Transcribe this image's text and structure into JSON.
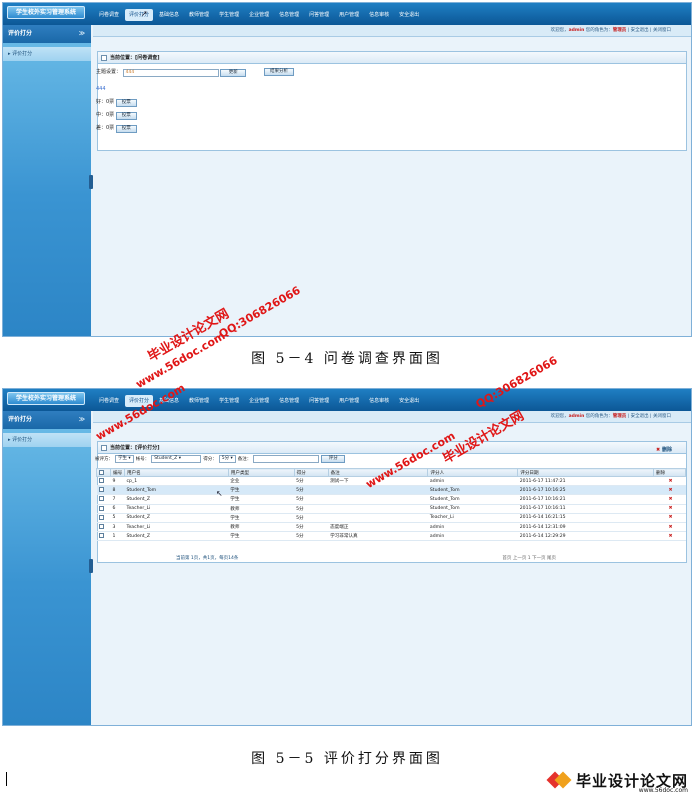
{
  "app_title": "学生校外实习管理系统",
  "nav": [
    "问卷调查",
    "评价打分",
    "基础信息",
    "教师管理",
    "学生管理",
    "企业管理",
    "信息管理",
    "问答管理",
    "用户管理",
    "信息审核",
    "安全退出"
  ],
  "status": {
    "welcome": "欢迎您，",
    "user": "admin",
    "role_prefix": " 您的角色为：",
    "role": "管理员",
    "logout": " | 安全退出",
    "close": " | 关闭窗口"
  },
  "sidebar": {
    "section": "评价打分",
    "item": "评价打分",
    "chevron": "≫"
  },
  "survey": {
    "location": "当前位置：[问卷调查]",
    "topic_label": "主题设置：",
    "topic_value": "444",
    "update_button": "更新",
    "result_button": "结果分析",
    "preview": "444",
    "options": [
      {
        "label": "好：0票",
        "button": "投票"
      },
      {
        "label": "中：0票",
        "button": "投票"
      },
      {
        "label": "差：0票",
        "button": "投票"
      }
    ],
    "caption": "图 5－4 问卷调查界面图"
  },
  "rating": {
    "location": "当前位置：[评价打分]",
    "delete_link": "删除",
    "filter": {
      "target_label": "被评方：",
      "target_value": "学生",
      "account_label": "帐号：",
      "account_value": "Student_Z",
      "score_label": "得分：",
      "score_value": "5分",
      "remark_label": "备注：",
      "submit": "评分"
    },
    "columns": [
      "编号",
      "用户名",
      "用户类型",
      "得分",
      "备注",
      "评分人",
      "评分日期",
      "删除"
    ],
    "rows": [
      {
        "id": "9",
        "user": "cp_1",
        "type": "企业",
        "score": "5分",
        "note": "测试一下",
        "rater": "admin",
        "date": "2011-6-17 11:47:21"
      },
      {
        "id": "8",
        "user": "Student_Tom",
        "type": "学生",
        "score": "5分",
        "note": "",
        "rater": "Student_Tom",
        "date": "2011-6-17 10:16:25"
      },
      {
        "id": "7",
        "user": "Student_Z",
        "type": "学生",
        "score": "5分",
        "note": "",
        "rater": "Student_Tom",
        "date": "2011-6-17 10:16:21"
      },
      {
        "id": "6",
        "user": "Teacher_Li",
        "type": "教师",
        "score": "5分",
        "note": "",
        "rater": "Student_Tom",
        "date": "2011-6-17 10:16:11"
      },
      {
        "id": "5",
        "user": "Student_Z",
        "type": "学生",
        "score": "5分",
        "note": "",
        "rater": "Teacher_Li",
        "date": "2011-6-14 16:21:15"
      },
      {
        "id": "3",
        "user": "Teacher_Li",
        "type": "教师",
        "score": "5分",
        "note": "态度端正",
        "rater": "admin",
        "date": "2011-6-14 12:31:09"
      },
      {
        "id": "1",
        "user": "Student_Z",
        "type": "学生",
        "score": "5分",
        "note": "学习非常认真",
        "rater": "admin",
        "date": "2011-6-14 12:29:29"
      }
    ],
    "delete_mark": "✖",
    "pager_info": "当前第 1页，共1页，每页14条",
    "pager_nav": "首页 上一页 1 下一页 尾页",
    "caption": "图 5－5 评价打分界面图"
  },
  "watermarks": {
    "brand": "毕业设计论文网",
    "url": "www.56doc.com",
    "qq": "QQ:306826066"
  },
  "footer": {
    "brand": "毕业设计论文网",
    "url": "www.56doc.com"
  },
  "colors": {
    "frame_blue": "#0c5796",
    "watermark_red": "#e01616",
    "delete_red": "#c81e1e"
  }
}
